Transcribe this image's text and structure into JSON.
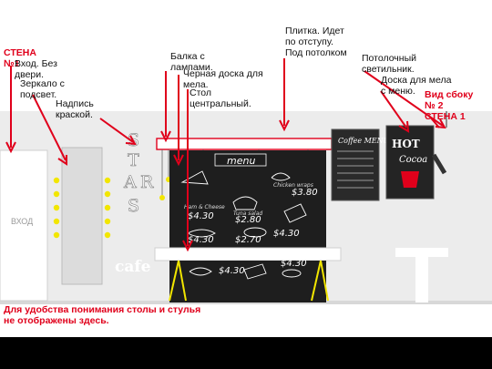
{
  "labels": {
    "wall1": "СТЕНА №1",
    "entrance": "Вход. Без двери.",
    "mirror": "Зеркало с подсвет.",
    "painted_sign": "Надпись краской.",
    "beam": "Балка с лампами.",
    "blackboard": "Черная доска для мела.",
    "table": "Стол центральный.",
    "tiles": "Плитка. Идет по отступу. Под потолком",
    "ceiling_light": "Потолочный светильник.",
    "chalk_board": "Доска для мела с меню.",
    "side_view": "Вид сбоку № 2",
    "wall2": "СТЕНА 1"
  },
  "entrance_door_text": "ВХОД",
  "wall_lettering": [
    "S",
    "T",
    "A",
    "R",
    "S"
  ],
  "cafe_text": "cafe",
  "menu_board": {
    "title": "menu",
    "prices": [
      "$4.30",
      "$2.80",
      "$3.80",
      "$4.30",
      "$2.70",
      "$4.30"
    ],
    "captions": [
      "Ham & Cheese",
      "Tuna salad",
      "Chicken wraps"
    ]
  },
  "poster_coffee": {
    "title": "Coffee MENU"
  },
  "poster_hot": {
    "title": "HOT",
    "subtitle": "Cocoa"
  },
  "footer_note": "Для удобства понимания столы и стулья не отображены здесь.",
  "colors": {
    "annotation_red": "#e0001b",
    "lamp_yellow": "#f2e600",
    "wall_gray": "#ececec",
    "board_dark": "#1e1e1e"
  }
}
